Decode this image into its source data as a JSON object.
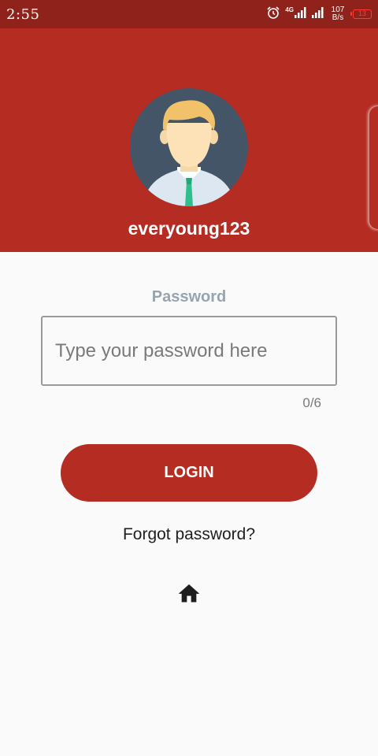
{
  "status_bar": {
    "time": "2:55",
    "network_label": "4G",
    "speed_value": "107",
    "speed_unit": "B/s",
    "battery_level": "13",
    "icons": [
      "alarm-icon",
      "signal-icon",
      "signal-icon",
      "battery-icon"
    ]
  },
  "profile": {
    "username": "everyoung123"
  },
  "form": {
    "password_label": "Password",
    "password_placeholder": "Type your password here",
    "password_value": "",
    "char_counter": "0/6",
    "login_label": "LOGIN",
    "forgot_label": "Forgot password?"
  },
  "nav": {
    "home_icon": "home-icon"
  },
  "colors": {
    "status_bar": "#8f231c",
    "header": "#b52d22",
    "accent": "#b52d22",
    "label": "#97a4b0",
    "background": "#fafafa"
  }
}
